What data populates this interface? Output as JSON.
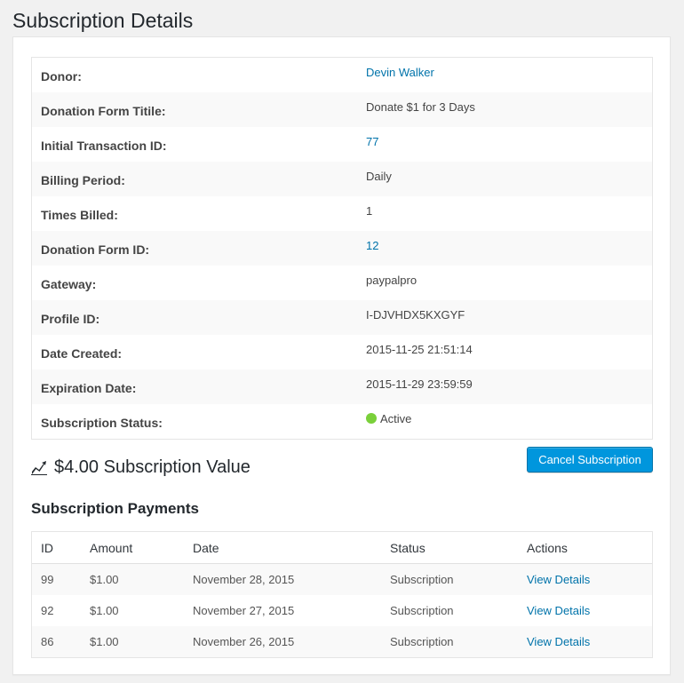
{
  "page": {
    "title": "Subscription Details"
  },
  "details": [
    {
      "label": "Donor:",
      "value": "Devin Walker",
      "link": true
    },
    {
      "label": "Donation Form Titile:",
      "value": "Donate $1 for 3 Days",
      "link": false
    },
    {
      "label": "Initial Transaction ID:",
      "value": "77",
      "link": true
    },
    {
      "label": "Billing Period:",
      "value": "Daily",
      "link": false
    },
    {
      "label": "Times Billed:",
      "value": "1",
      "link": false
    },
    {
      "label": "Donation Form ID:",
      "value": "12",
      "link": true
    },
    {
      "label": "Gateway:",
      "value": "paypalpro",
      "link": false
    },
    {
      "label": "Profile ID:",
      "value": "I-DJVHDX5KXGYF",
      "link": false
    },
    {
      "label": "Date Created:",
      "value": "2015-11-25 21:51:14",
      "link": false
    },
    {
      "label": "Expiration Date:",
      "value": "2015-11-29 23:59:59",
      "link": false
    },
    {
      "label": "Subscription Status:",
      "value": "Active",
      "link": false,
      "status_color": "#7ad03a"
    }
  ],
  "summary": {
    "value_text": "$4.00 Subscription Value",
    "icon": "chart-icon",
    "cancel_label": "Cancel Subscription"
  },
  "payments": {
    "heading": "Subscription Payments",
    "columns": [
      "ID",
      "Amount",
      "Date",
      "Status",
      "Actions"
    ],
    "rows": [
      {
        "id": "99",
        "amount": "$1.00",
        "date": "November 28, 2015",
        "status": "Subscription",
        "action": "View Details"
      },
      {
        "id": "92",
        "amount": "$1.00",
        "date": "November 27, 2015",
        "status": "Subscription",
        "action": "View Details"
      },
      {
        "id": "86",
        "amount": "$1.00",
        "date": "November 26, 2015",
        "status": "Subscription",
        "action": "View Details"
      }
    ]
  },
  "colors": {
    "accent": "#0073aa",
    "button": "#0096dd",
    "active": "#7ad03a"
  }
}
